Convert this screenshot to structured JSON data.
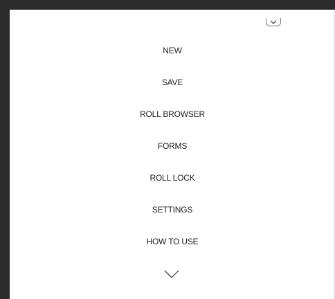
{
  "menu": {
    "items": [
      {
        "label": "NEW"
      },
      {
        "label": "SAVE"
      },
      {
        "label": "ROLL BROWSER"
      },
      {
        "label": "FORMS"
      },
      {
        "label": "ROLL LOCK"
      },
      {
        "label": "SETTINGS"
      },
      {
        "label": "HOW TO USE"
      }
    ]
  },
  "icons": {
    "top": "chevron-down-icon",
    "bottom": "chevron-down-icon"
  },
  "colors": {
    "frame": "#2b2b2b",
    "background": "#ffffff",
    "text": "#1e1e1e",
    "icon": "#555555"
  }
}
